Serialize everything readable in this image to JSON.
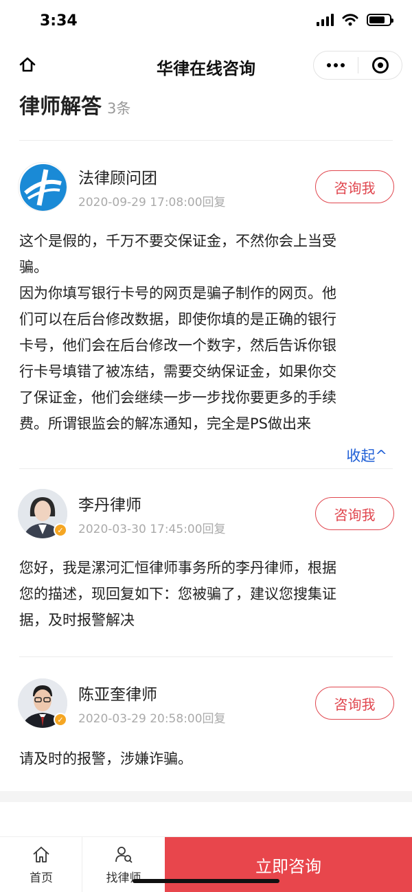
{
  "status_bar": {
    "time": "3:34"
  },
  "nav": {
    "title": "华律在线咨询"
  },
  "section": {
    "title": "律师解答",
    "count": "3条"
  },
  "answers": [
    {
      "name": "法律顾问团",
      "time": "2020-09-29 17:08:00回复",
      "consult_label": "咨询我",
      "lines": [
        "这个是假的，千万不要交保证金，不然你会上当受",
        "骗。",
        "因为你填写银行卡号的网页是骗子制作的网页。他",
        "们可以在后台修改数据，即使你填的是正确的银行",
        "卡号，他们会在后台修改一个数字，然后告诉你银",
        "行卡号填错了被冻结，需要交纳保证金，如果你交",
        "了保证金，他们会继续一步一步找你要更多的手续",
        "费。所谓银监会的解冻通知，完全是PS做出来"
      ],
      "collapse_label": "收起^"
    },
    {
      "name": "李丹律师",
      "time": "2020-03-30 17:45:00回复",
      "consult_label": "咨询我",
      "lines": [
        "您好，我是漯河汇恒律师事务所的李丹律师，根据",
        "您的描述，现回复如下：您被骗了，建议您搜集证",
        "据，及时报警解决"
      ]
    },
    {
      "name": "陈亚奎律师",
      "time": "2020-03-29 20:58:00回复",
      "consult_label": "咨询我",
      "lines": [
        "请及时的报警，涉嫌诈骗。"
      ]
    }
  ],
  "bottom_bar": {
    "tabs": [
      {
        "label": "首页",
        "icon": "home-icon"
      },
      {
        "label": "找律师",
        "icon": "find-lawyer-icon"
      }
    ],
    "cta": "立即咨询"
  },
  "colors": {
    "accent": "#e8464c",
    "link": "#1f5fd6",
    "verified": "#f5a623"
  }
}
